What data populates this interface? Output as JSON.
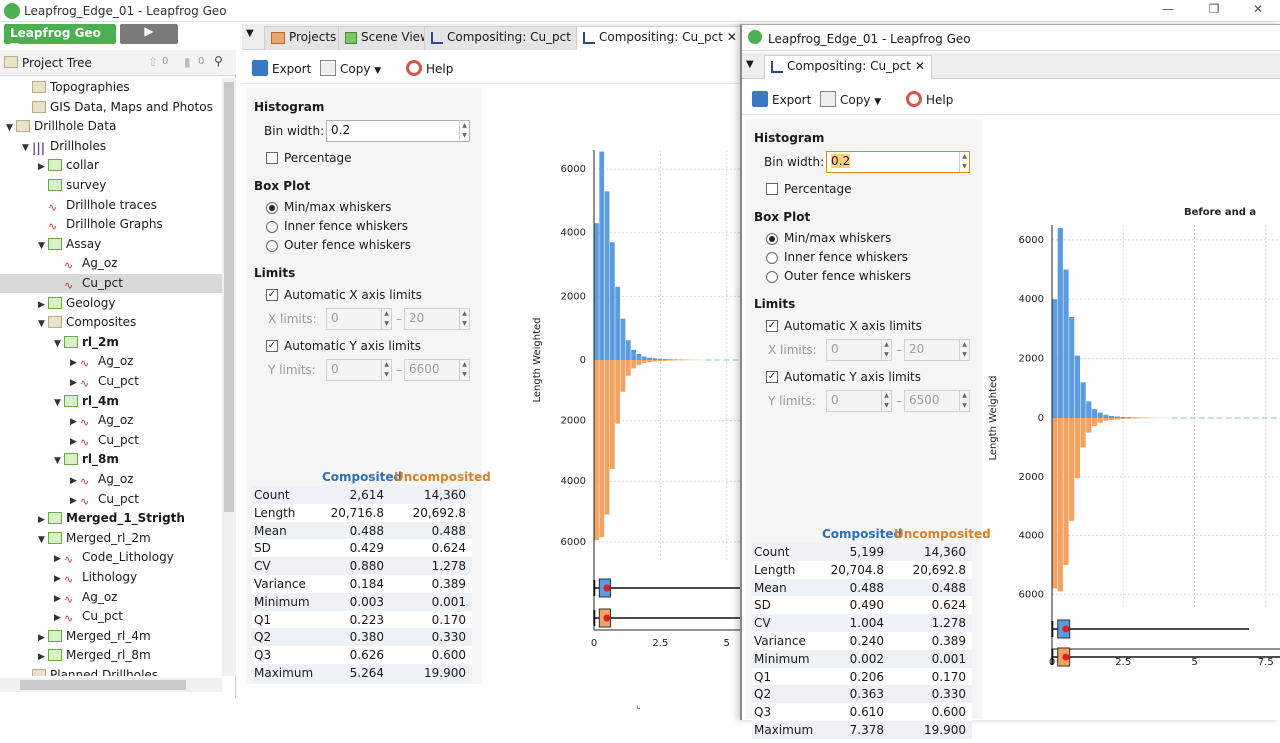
{
  "window": {
    "title": "Leapfrog_Edge_01 - Leapfrog Geo",
    "min": "—",
    "max": "❐",
    "close": "✕"
  },
  "appbar": {
    "product": "Leapfrog Geo",
    "play": "▶"
  },
  "tree": {
    "title": "Project Tree",
    "items": [
      {
        "label": "Topographies",
        "level": 1,
        "icon": "folder",
        "tw": ""
      },
      {
        "label": "GIS Data, Maps and Photos",
        "level": 1,
        "icon": "folder",
        "tw": ""
      },
      {
        "label": "Drillhole Data",
        "level": 0,
        "icon": "folder",
        "tw": "▼"
      },
      {
        "label": "Drillholes",
        "level": 1,
        "icon": "drill",
        "tw": "▼"
      },
      {
        "label": "collar",
        "level": 2,
        "icon": "table",
        "tw": "▶"
      },
      {
        "label": "survey",
        "level": 2,
        "icon": "table",
        "tw": ""
      },
      {
        "label": "Drillhole traces",
        "level": 2,
        "icon": "graph",
        "tw": ""
      },
      {
        "label": "Drillhole Graphs",
        "level": 2,
        "icon": "graph",
        "tw": ""
      },
      {
        "label": "Assay",
        "level": 2,
        "icon": "table",
        "tw": "▼"
      },
      {
        "label": "Ag_oz",
        "level": 3,
        "icon": "graph",
        "tw": ""
      },
      {
        "label": "Cu_pct",
        "level": 3,
        "icon": "graph",
        "tw": "",
        "selected": true
      },
      {
        "label": "Geology",
        "level": 2,
        "icon": "table",
        "tw": "▶"
      },
      {
        "label": "Composites",
        "level": 2,
        "icon": "folder",
        "tw": "▼"
      },
      {
        "label": "rl_2m",
        "level": 3,
        "icon": "table",
        "tw": "▼",
        "bold": true
      },
      {
        "label": "Ag_oz",
        "level": 4,
        "icon": "graph",
        "tw": "▶"
      },
      {
        "label": "Cu_pct",
        "level": 4,
        "icon": "graph",
        "tw": "▶"
      },
      {
        "label": "rl_4m",
        "level": 3,
        "icon": "table",
        "tw": "▼",
        "bold": true
      },
      {
        "label": "Ag_oz",
        "level": 4,
        "icon": "graph",
        "tw": "▶"
      },
      {
        "label": "Cu_pct",
        "level": 4,
        "icon": "graph",
        "tw": "▶"
      },
      {
        "label": "rl_8m",
        "level": 3,
        "icon": "table",
        "tw": "▼",
        "bold": true
      },
      {
        "label": "Ag_oz",
        "level": 4,
        "icon": "graph",
        "tw": "▶"
      },
      {
        "label": "Cu_pct",
        "level": 4,
        "icon": "graph",
        "tw": "▶"
      },
      {
        "label": "Merged_1_Strigth",
        "level": 2,
        "icon": "table",
        "tw": "▶",
        "bold": true
      },
      {
        "label": "Merged_rl_2m",
        "level": 2,
        "icon": "table",
        "tw": "▼"
      },
      {
        "label": "Code_Lithology",
        "level": 3,
        "icon": "graph",
        "tw": "▶"
      },
      {
        "label": "Lithology",
        "level": 3,
        "icon": "graph",
        "tw": "▶"
      },
      {
        "label": "Ag_oz",
        "level": 3,
        "icon": "graph",
        "tw": "▶"
      },
      {
        "label": "Cu_pct",
        "level": 3,
        "icon": "graph",
        "tw": "▶"
      },
      {
        "label": "Merged_rl_4m",
        "level": 2,
        "icon": "table",
        "tw": "▶"
      },
      {
        "label": "Merged_rl_8m",
        "level": 2,
        "icon": "table",
        "tw": "▶"
      },
      {
        "label": "Planned Drillholes",
        "level": 1,
        "icon": "folder",
        "tw": ""
      }
    ],
    "counter1": "0",
    "counter2": "0"
  },
  "tabs": [
    {
      "label": "Projects"
    },
    {
      "label": "Scene View"
    },
    {
      "label": "Compositing: Cu_pct",
      "close": "✕"
    },
    {
      "label": "Compositing: Cu_pct",
      "close": "✕",
      "active": true
    }
  ],
  "toolbar": {
    "export": "Export",
    "copy": "Copy",
    "help": "Help"
  },
  "left_panel": {
    "histogram": "Histogram",
    "bin_width_label": "Bin width:",
    "bin_width": "0.2",
    "percentage": "Percentage",
    "box_plot": "Box Plot",
    "box_opts": [
      "Min/max whiskers",
      "Inner fence whiskers",
      "Outer fence whiskers"
    ],
    "limits": "Limits",
    "auto_x": "Automatic X axis limits",
    "x_limits": "X limits:",
    "x_min": "0",
    "x_max": "20",
    "auto_y": "Automatic Y axis limits",
    "y_limits": "Y limits:",
    "y_min": "0",
    "y_max": "6600",
    "dash": "–",
    "stats_headers": [
      "Composited",
      "Uncomposited"
    ],
    "stats": [
      [
        "Count",
        "2,614",
        "14,360"
      ],
      [
        "Length",
        "20,716.8",
        "20,692.8"
      ],
      [
        "Mean",
        "0.488",
        "0.488"
      ],
      [
        "SD",
        "0.429",
        "0.624"
      ],
      [
        "CV",
        "0.880",
        "1.278"
      ],
      [
        "Variance",
        "0.184",
        "0.389"
      ],
      [
        "Minimum",
        "0.003",
        "0.001"
      ],
      [
        "Q1",
        "0.223",
        "0.170"
      ],
      [
        "Q2",
        "0.380",
        "0.330"
      ],
      [
        "Q3",
        "0.626",
        "0.600"
      ],
      [
        "Maximum",
        "5.264",
        "19.900"
      ]
    ]
  },
  "float_window": {
    "title": "Leapfrog_Edge_01 - Leapfrog Geo",
    "tab": "Compositing: Cu_pct",
    "tab_close": "✕",
    "bin_width": "0.2",
    "y_max": "6500",
    "x_max": "20",
    "chart_title": "Before and a",
    "stats": [
      [
        "Count",
        "5,199",
        "14,360"
      ],
      [
        "Length",
        "20,704.8",
        "20,692.8"
      ],
      [
        "Mean",
        "0.488",
        "0.488"
      ],
      [
        "SD",
        "0.490",
        "0.624"
      ],
      [
        "CV",
        "1.004",
        "1.278"
      ],
      [
        "Variance",
        "0.240",
        "0.389"
      ],
      [
        "Minimum",
        "0.002",
        "0.001"
      ],
      [
        "Q1",
        "0.206",
        "0.170"
      ],
      [
        "Q2",
        "0.363",
        "0.330"
      ],
      [
        "Q3",
        "0.610",
        "0.600"
      ],
      [
        "Maximum",
        "7.378",
        "19.900"
      ]
    ]
  },
  "chart_data": [
    {
      "type": "bar",
      "ylabel": "Length Weighted",
      "xlim": [
        0,
        5.5
      ],
      "ylim_top": [
        0,
        6600
      ],
      "ylim_bottom": [
        0,
        6600
      ],
      "y_ticks": [
        6000,
        4000,
        2000,
        0,
        2000,
        4000,
        6000
      ],
      "x_ticks": [
        "0",
        "2.5",
        "5"
      ],
      "bin_width": 0.2,
      "series": [
        {
          "name": "Composited",
          "color": "#5b9be0",
          "values": [
            4300,
            6550,
            5300,
            3700,
            2300,
            1300,
            620,
            320,
            190,
            110,
            75,
            55,
            40,
            30,
            22,
            18,
            14,
            10,
            8,
            6,
            4
          ]
        },
        {
          "name": "Uncomposited",
          "color": "#f4a261",
          "values": [
            5950,
            5850,
            5100,
            3600,
            2100,
            1050,
            520,
            280,
            170,
            100,
            70,
            50,
            38,
            28,
            20,
            15,
            12,
            9,
            7,
            5,
            3
          ]
        }
      ]
    },
    {
      "type": "bar",
      "title": "Before and a",
      "ylabel": "Length Weighted",
      "xlim": [
        0,
        8
      ],
      "ylim_top": [
        0,
        6500
      ],
      "ylim_bottom": [
        0,
        6500
      ],
      "y_ticks": [
        6000,
        4000,
        2000,
        0,
        2000,
        4000,
        6000
      ],
      "x_ticks": [
        "0",
        "2.5",
        "5",
        "7.5"
      ],
      "bin_width": 0.2,
      "series": [
        {
          "name": "Composited",
          "color": "#5b9be0",
          "values": [
            4000,
            6400,
            5000,
            3400,
            2100,
            1200,
            560,
            300,
            180,
            110,
            70,
            50,
            36,
            26,
            20,
            15,
            11,
            8,
            6,
            5,
            4
          ]
        },
        {
          "name": "Uncomposited",
          "color": "#f4a261",
          "values": [
            5800,
            5900,
            5000,
            3500,
            2050,
            1000,
            500,
            270,
            160,
            95,
            65,
            46,
            34,
            25,
            18,
            13,
            10,
            8,
            6,
            4,
            3
          ]
        }
      ]
    }
  ]
}
